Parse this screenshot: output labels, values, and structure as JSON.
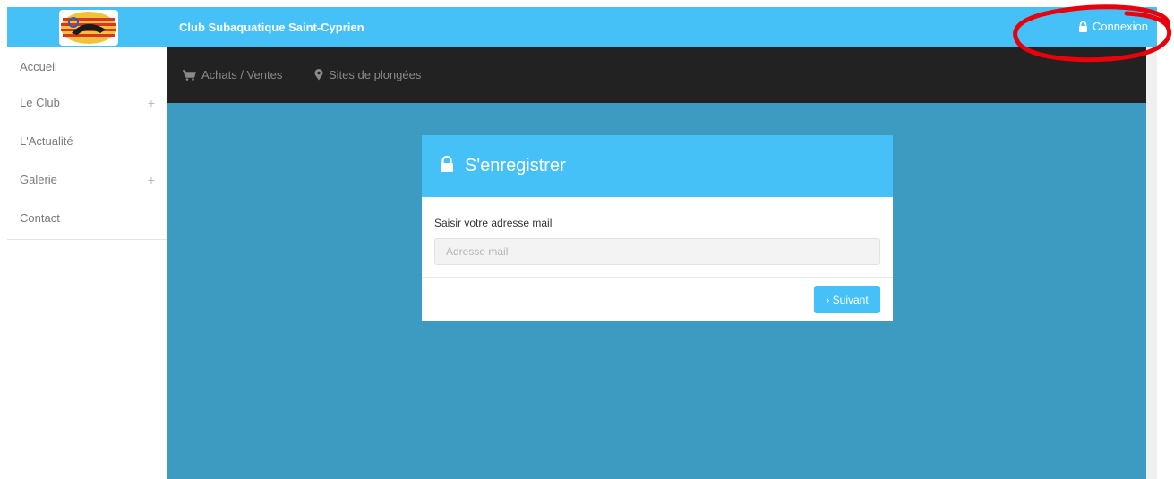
{
  "header": {
    "site_title": "Club Subaquatique Saint-Cyprien",
    "login_label": "Connexion",
    "login_icon": "lock-icon",
    "logo_icon": "club-logo-icon"
  },
  "sidebar": {
    "items": [
      {
        "label": "Accueil",
        "expandable": false
      },
      {
        "label": "Le Club",
        "expandable": true,
        "expand_glyph": "+"
      },
      {
        "label": "L'Actualité",
        "expandable": false
      },
      {
        "label": "Galerie",
        "expandable": true,
        "expand_glyph": "+"
      },
      {
        "label": "Contact",
        "expandable": false
      }
    ]
  },
  "navbar": {
    "items": [
      {
        "label": "Achats / Ventes",
        "icon": "cart-icon"
      },
      {
        "label": "Sites de plongées",
        "icon": "map-marker-icon"
      }
    ]
  },
  "login_card": {
    "title": "S'enregistrer",
    "title_icon": "lock-icon",
    "email_label": "Saisir votre adresse mail",
    "email_placeholder": "Adresse mail",
    "email_value": "",
    "next_label": "› Suivant"
  },
  "colors": {
    "accent": "#45c1f7",
    "navbar_bg": "#222222",
    "main_bg": "#3d9ac0",
    "annotation": "#e8000b"
  }
}
